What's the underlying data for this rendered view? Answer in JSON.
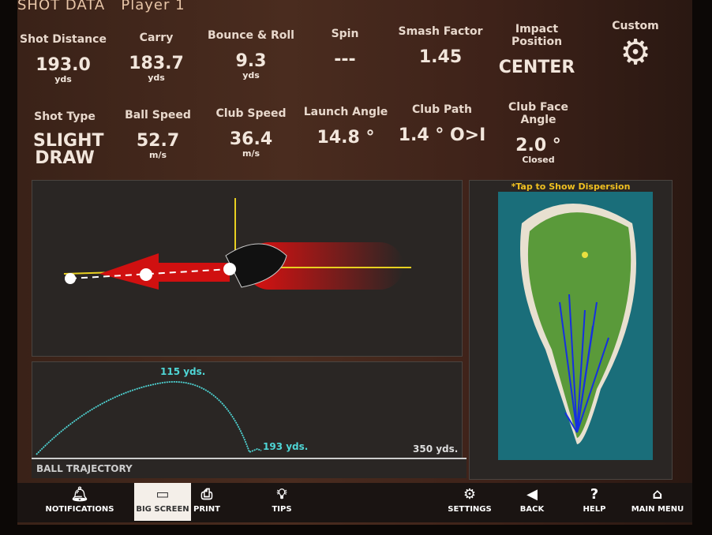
{
  "header": {
    "title": "SHOT DATA",
    "player": "Player 1"
  },
  "stats_row1": [
    {
      "label": "Shot Distance",
      "value": "193.0",
      "unit": "yds"
    },
    {
      "label": "Carry",
      "value": "183.7",
      "unit": "yds"
    },
    {
      "label": "Bounce & Roll",
      "value": "9.3",
      "unit": "yds"
    },
    {
      "label": "Spin",
      "value": "---",
      "unit": ""
    },
    {
      "label": "Smash Factor",
      "value": "1.45",
      "unit": ""
    },
    {
      "label": "Impact Position",
      "value": "CENTER",
      "unit": ""
    },
    {
      "label": "Custom",
      "value": "",
      "unit": ""
    }
  ],
  "stats_row2": [
    {
      "label": "Shot Type",
      "value": "SLIGHT DRAW",
      "unit": ""
    },
    {
      "label": "Ball Speed",
      "value": "52.7",
      "unit": "m/s"
    },
    {
      "label": "Club Speed",
      "value": "36.4",
      "unit": "m/s"
    },
    {
      "label": "Launch Angle",
      "value": "14.8 °",
      "unit": ""
    },
    {
      "label": "Club Path",
      "value": "1.4 ° O>I",
      "unit": ""
    },
    {
      "label": "Club Face Angle",
      "value": "2.0 °",
      "unit": "Closed"
    }
  ],
  "trajectory": {
    "label": "BALL TRAJECTORY",
    "peak_label": "115 yds.",
    "end_label": "193 yds.",
    "max_label": "350 yds.",
    "color": "#4fd6d6"
  },
  "map": {
    "hint": "*Tap to Show Dispersion",
    "hint_color": "#f0c020"
  },
  "toolbar": [
    {
      "label": "NOTIFICATIONS",
      "icon": "bell-icon"
    },
    {
      "label": "BIG SCREEN",
      "icon": "cast-icon",
      "selected": true
    },
    {
      "label": "PRINT",
      "icon": "printer-icon"
    },
    {
      "label": "TIPS",
      "icon": "lightbulb-icon"
    },
    {
      "label": "SETTINGS",
      "icon": "gear-icon"
    },
    {
      "label": "BACK",
      "icon": "back-arrow-icon"
    },
    {
      "label": "HELP",
      "icon": "question-icon"
    },
    {
      "label": "MAIN MENU",
      "icon": "home-icon"
    }
  ]
}
